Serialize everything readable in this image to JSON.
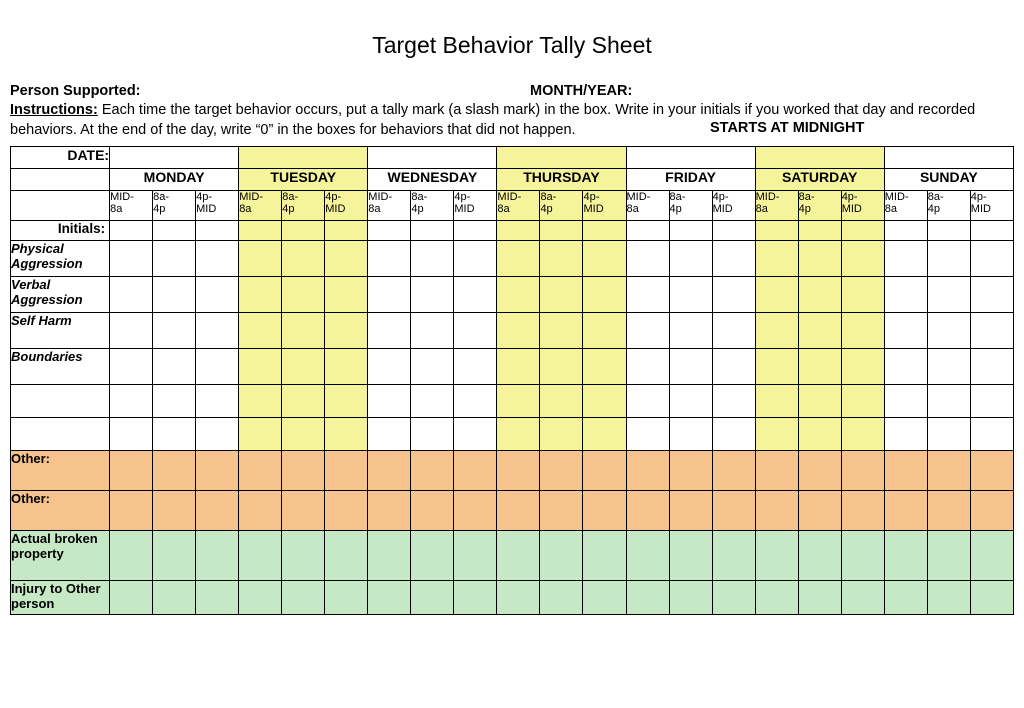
{
  "title": "Target Behavior Tally Sheet",
  "meta": {
    "person_label": "Person Supported:",
    "month_label": "MONTH/YEAR:"
  },
  "instructions": {
    "label": "Instructions:",
    "text": "  Each time the target behavior occurs, put a tally mark (a slash mark) in the box.  Write in your initials if you worked that day and recorded behaviors.  At the end of the day, write “0” in the boxes for behaviors that did not happen.",
    "starts": "STARTS AT MIDNIGHT"
  },
  "headers": {
    "date": "DATE:",
    "days": [
      "MONDAY",
      "TUESDAY",
      "WEDNESDAY",
      "THURSDAY",
      "FRIDAY",
      "SATURDAY",
      "SUNDAY"
    ],
    "shifts": [
      "MID-8a",
      "8a-4p",
      "4p-MID"
    ],
    "initials": "Initials:"
  },
  "rows": {
    "behaviors": [
      "Physical Aggression",
      "Verbal Aggression",
      "Self Harm",
      "Boundaries"
    ],
    "blank": [
      "",
      ""
    ],
    "other": [
      "Other:",
      "Other:"
    ],
    "green": [
      "Actual broken property",
      "Injury to Other person"
    ]
  },
  "highlight_days": [
    1,
    3,
    5
  ]
}
